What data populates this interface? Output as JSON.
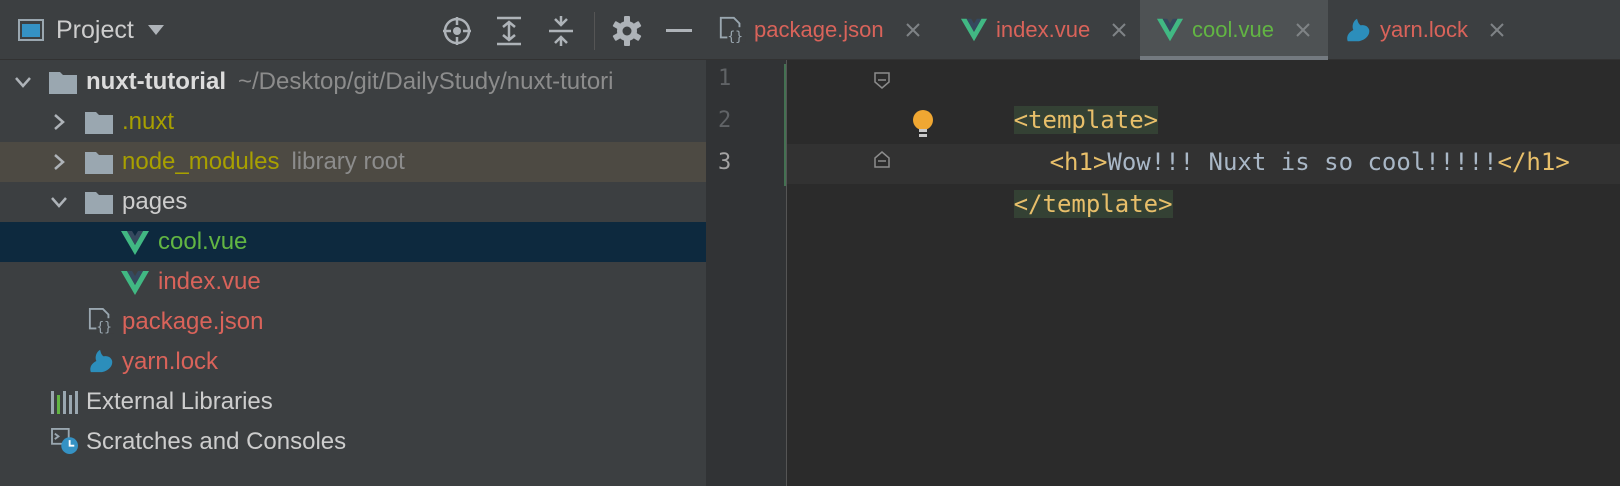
{
  "project_panel": {
    "title": "Project",
    "icons": [
      "window-icon",
      "caret-down-icon",
      "locate-icon",
      "expand-all-icon",
      "collapse-all-icon",
      "gear-icon",
      "minimize-icon"
    ]
  },
  "tree": {
    "root": {
      "name": "nuxt-tutorial",
      "path": "~/Desktop/git/DailyStudy/nuxt-tutori"
    },
    "nuxt": ".nuxt",
    "node_modules": {
      "name": "node_modules",
      "note": "library root"
    },
    "pages": "pages",
    "cool": "cool.vue",
    "index": "index.vue",
    "package": "package.json",
    "yarn": "yarn.lock",
    "external": "External Libraries",
    "scratches": "Scratches and Consoles"
  },
  "tabs": [
    {
      "label": "package.json",
      "icon": "json-file-icon",
      "color": "#d9635a"
    },
    {
      "label": "index.vue",
      "icon": "vue-icon",
      "color": "#d9635a"
    },
    {
      "label": "cool.vue",
      "icon": "vue-icon",
      "color": "#62b543",
      "active": true
    },
    {
      "label": "yarn.lock",
      "icon": "yarn-icon",
      "color": "#d9635a"
    }
  ],
  "editor": {
    "line_numbers": [
      "1",
      "2",
      "3"
    ],
    "line1": "<template>",
    "line2_open": "<h1>",
    "line2_text": "Wow!!! Nuxt is so cool!!!!!",
    "line2_close": "</h1>",
    "line3": "</template>"
  },
  "colors": {
    "vue_green": "#41b883",
    "tag": "#e8bf6a",
    "modified_red": "#d9635a",
    "added_green": "#62b543",
    "library_olive": "#a8a000"
  }
}
